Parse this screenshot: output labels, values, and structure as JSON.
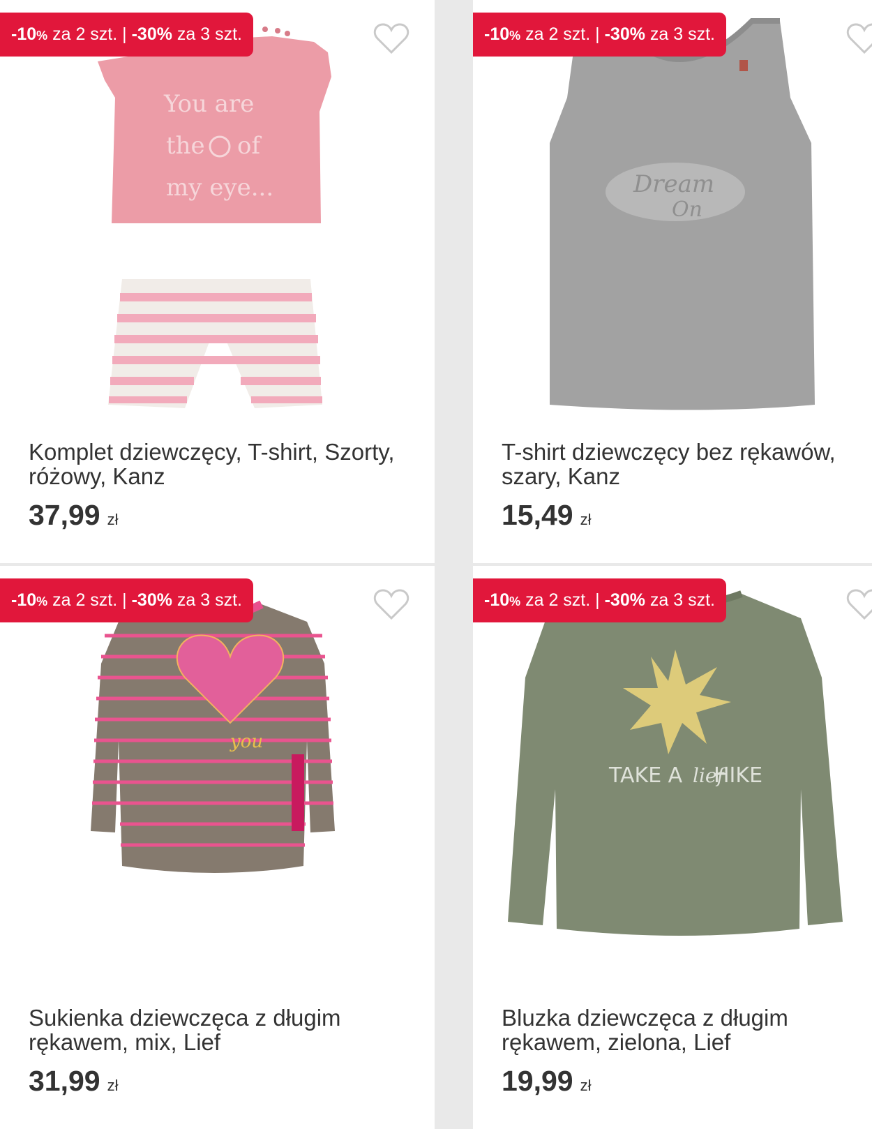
{
  "colors": {
    "badge": "#e1173b",
    "background": "#e9e9e9",
    "card": "#ffffff",
    "text": "#333333"
  },
  "products": [
    {
      "badge": {
        "pct1": "-10",
        "pct_sign": "%",
        "rest1": " za 2 szt. | ",
        "pct2": "-30%",
        "rest2": " za 3 szt."
      },
      "title": "Komplet dziewczęcy, T-shirt, Szorty, różowy, Kanz",
      "price": "37,99",
      "currency": "zł",
      "print_text": [
        "You are",
        "the",
        "of",
        "my eye..."
      ],
      "favorite_icon": "heart-outline-icon"
    },
    {
      "badge": {
        "pct1": "-10",
        "pct_sign": "%",
        "rest1": " za 2 szt. | ",
        "pct2": "-30%",
        "rest2": " za 3 szt."
      },
      "title": "T-shirt dziewczęcy bez rękawów, szary, Kanz",
      "price": "15,49",
      "currency": "zł",
      "print_text": [
        "Dream",
        "On"
      ],
      "favorite_icon": "heart-outline-icon"
    },
    {
      "badge": {
        "pct1": "-10",
        "pct_sign": "%",
        "rest1": " za 2 szt. | ",
        "pct2": "-30%",
        "rest2": " za 3 szt."
      },
      "title": "Sukienka dziewczęca z długim rękawem, mix, Lief",
      "price": "31,99",
      "currency": "zł",
      "print_text": [
        "you"
      ],
      "favorite_icon": "heart-outline-icon"
    },
    {
      "badge": {
        "pct1": "-10",
        "pct_sign": "%",
        "rest1": " za 2 szt. | ",
        "pct2": "-30%",
        "rest2": " za 3 szt."
      },
      "title": "Bluzka dziewczęca z długim rękawem, zielona, Lief",
      "price": "19,99",
      "currency": "zł",
      "print_text": [
        "TAKE A",
        "lief",
        "HIKE"
      ],
      "favorite_icon": "heart-outline-icon"
    }
  ]
}
